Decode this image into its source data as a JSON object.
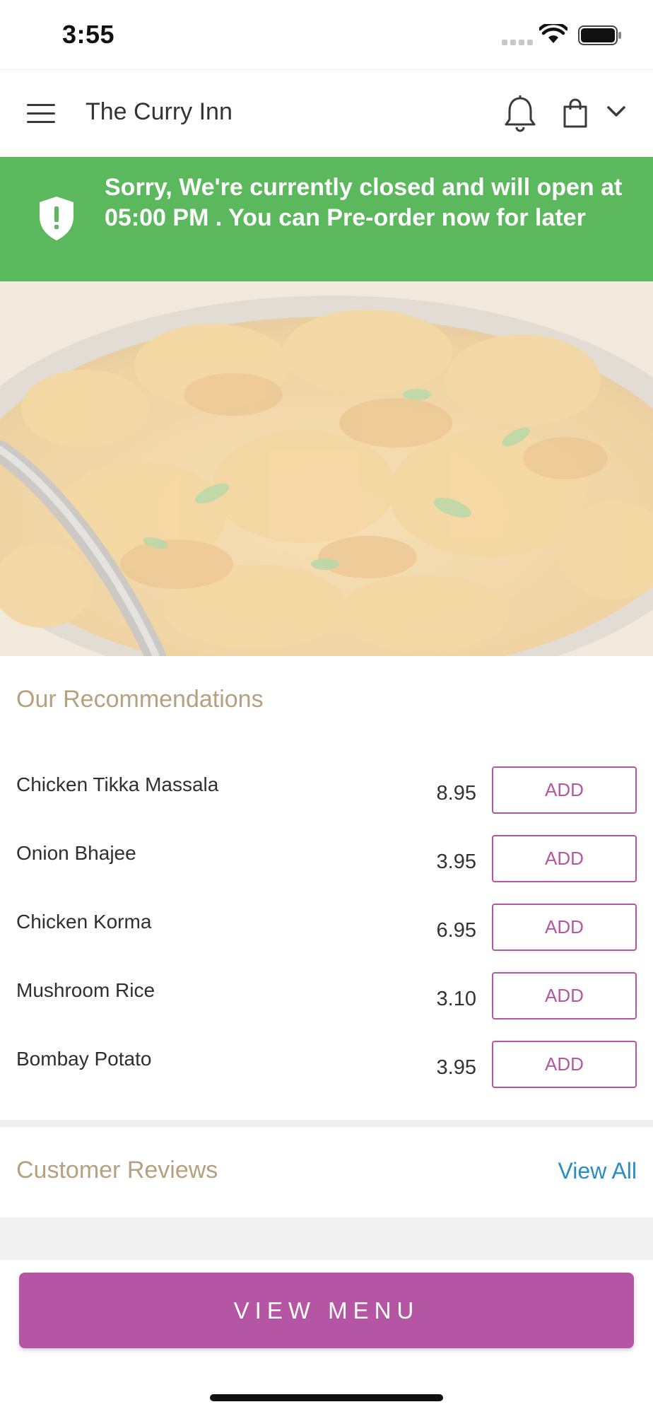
{
  "status_bar": {
    "time": "3:55"
  },
  "header": {
    "title": "The Curry Inn"
  },
  "banner": {
    "message": "Sorry, We're currently closed and will open at 05:00 PM . You can Pre-order now for later"
  },
  "recommendations": {
    "title": "Our Recommendations",
    "add_label": "ADD",
    "items": [
      {
        "name": "Chicken Tikka Massala",
        "price": "8.95"
      },
      {
        "name": "Onion Bhajee",
        "price": "3.95"
      },
      {
        "name": "Chicken Korma",
        "price": "6.95"
      },
      {
        "name": "Mushroom Rice",
        "price": "3.10"
      },
      {
        "name": "Bombay Potato",
        "price": "3.95"
      }
    ]
  },
  "reviews": {
    "title": "Customer Reviews",
    "view_all_label": "View All"
  },
  "footer": {
    "view_menu_label": "VIEW MENU"
  },
  "colors": {
    "accent": "#b556a5",
    "banner": "#5cb85c",
    "section_title": "#b5a17f",
    "link": "#2a8fc0"
  },
  "icons": [
    "menu-icon",
    "bell-icon",
    "shopping-bag-icon",
    "chevron-down-icon",
    "shield-alert-icon",
    "wifi-icon",
    "battery-icon"
  ]
}
